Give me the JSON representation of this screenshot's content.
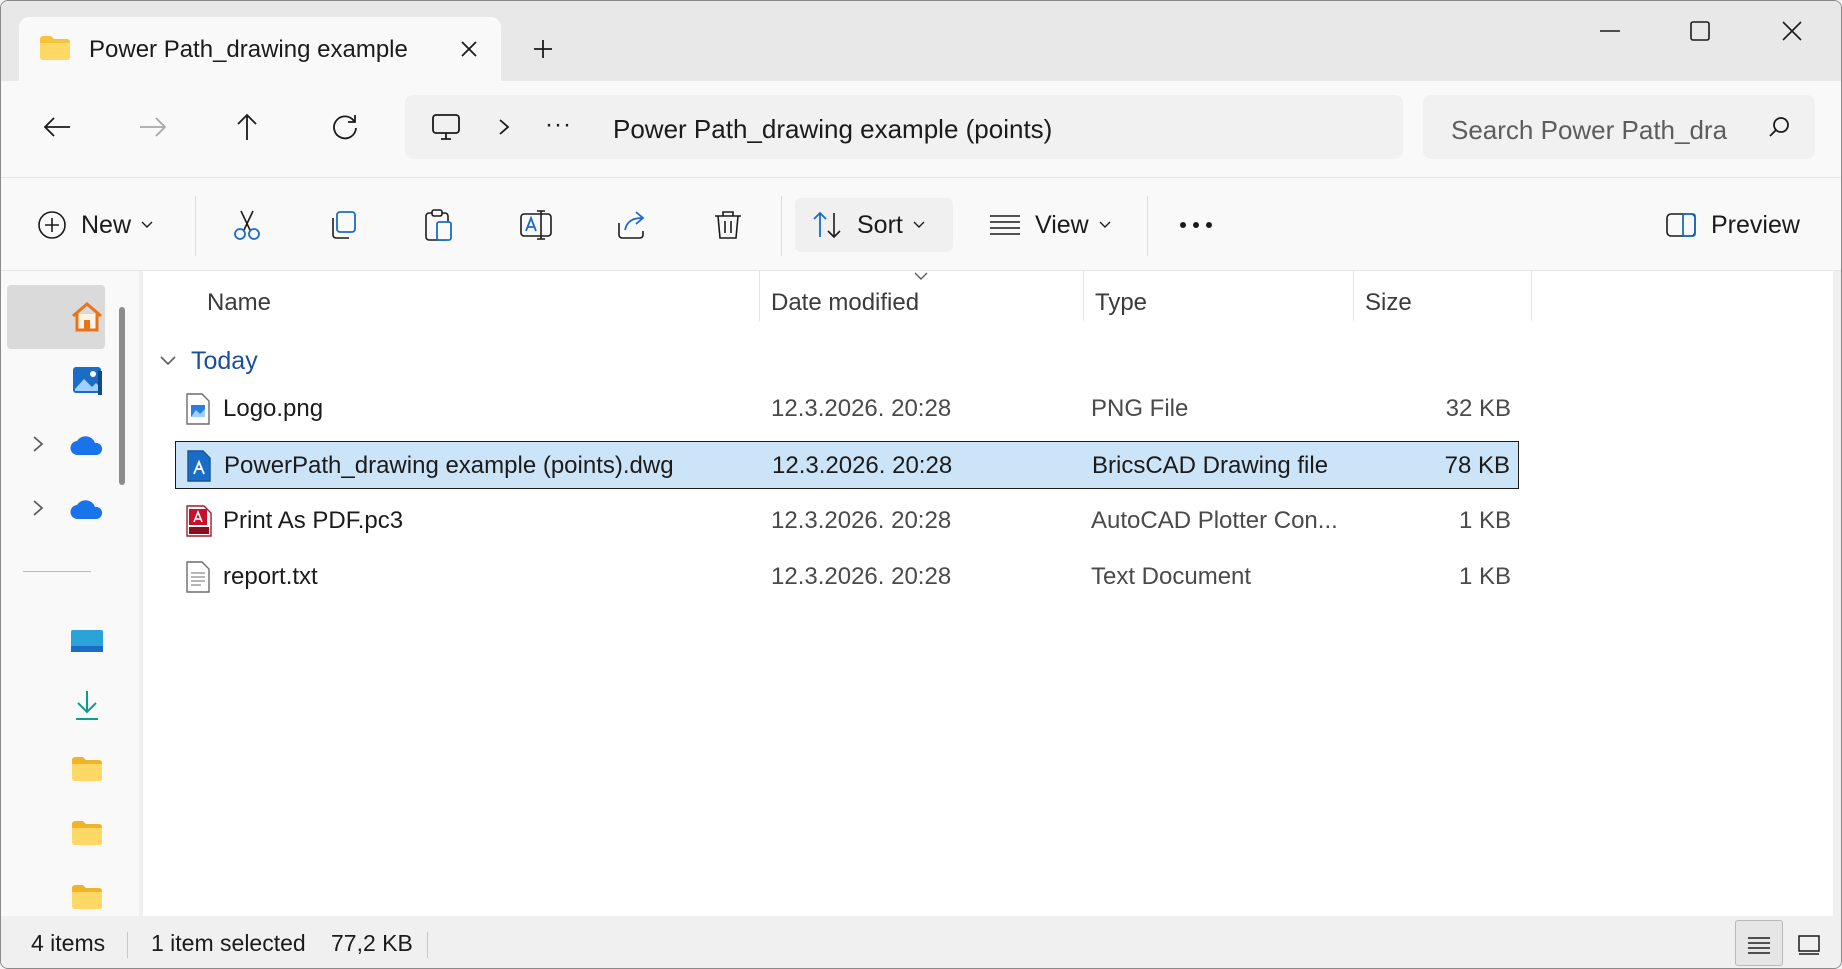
{
  "window": {
    "tab_title": "Power Path_drawing example",
    "new_tab_glyph": "+"
  },
  "address": {
    "more": "···",
    "current": "Power Path_drawing example (points)"
  },
  "search": {
    "placeholder": "Search Power Path_dra"
  },
  "commands": {
    "new_label": "New",
    "sort_label": "Sort",
    "view_label": "View",
    "more": "···",
    "preview_label": "Preview"
  },
  "columns": {
    "name": "Name",
    "date": "Date modified",
    "type": "Type",
    "size": "Size"
  },
  "group": {
    "label": "Today"
  },
  "files": [
    {
      "name": "Logo.png",
      "date": "12.3.2026. 20:28",
      "type": "PNG File",
      "size": "32 KB",
      "icon": "image-file-icon",
      "selected": false
    },
    {
      "name": "PowerPath_drawing example (points).dwg",
      "date": "12.3.2026. 20:28",
      "type": "BricsCAD Drawing file",
      "size": "78 KB",
      "icon": "bricscad-file-icon",
      "selected": true
    },
    {
      "name": "Print As PDF.pc3",
      "date": "12.3.2026. 20:28",
      "type": "AutoCAD Plotter Con...",
      "size": "1 KB",
      "icon": "autocad-plotter-icon",
      "selected": false
    },
    {
      "name": "report.txt",
      "date": "12.3.2026. 20:28",
      "type": "Text Document",
      "size": "1 KB",
      "icon": "text-file-icon",
      "selected": false
    }
  ],
  "status": {
    "items_count": "4 items",
    "selection": "1 item selected",
    "selection_size": "77,2 KB"
  },
  "colors": {
    "selection_bg": "#cce4f7",
    "group_label": "#1a4f9c",
    "folder": "#f8c33a"
  }
}
